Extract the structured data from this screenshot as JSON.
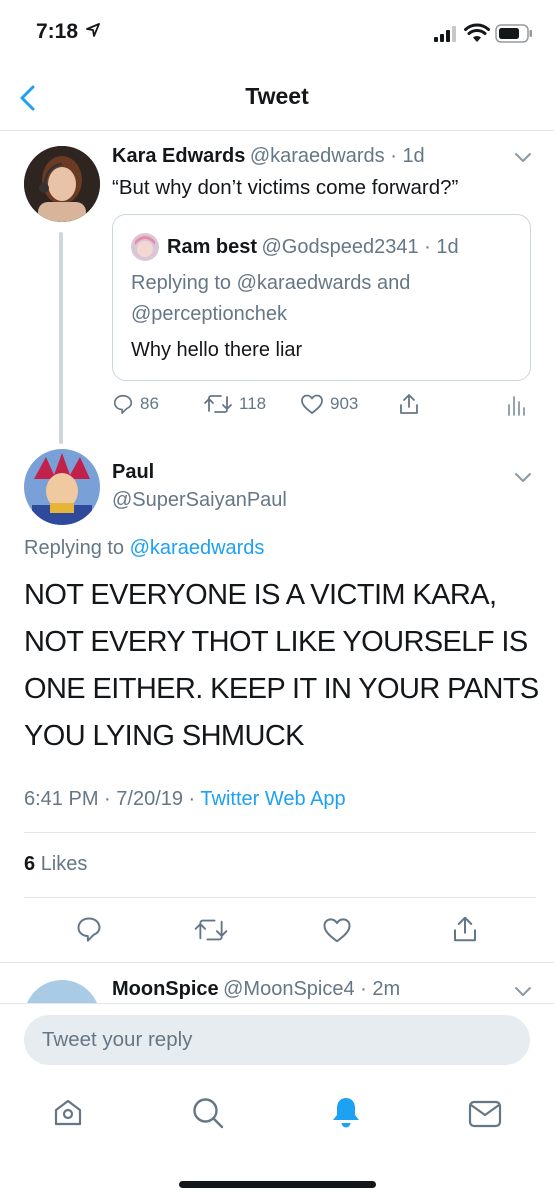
{
  "status_bar": {
    "time": "7:18"
  },
  "nav": {
    "title": "Tweet"
  },
  "parent_tweet": {
    "name": "Kara Edwards",
    "handle": "@karaedwards",
    "age": "1d",
    "text": "“But why don’t victims come forward?”",
    "quoted": {
      "name": "Ram best",
      "handle": "@Godspeed2341",
      "age": "1d",
      "replying_prefix": "Replying to",
      "replying_to_1": "@karaedwards",
      "replying_and": "and",
      "replying_to_2": "@perceptionchek",
      "text": "Why hello there liar"
    },
    "stats": {
      "replies": "86",
      "retweets": "118",
      "likes": "903"
    }
  },
  "main_tweet": {
    "name": "Paul",
    "handle": "@SuperSaiyanPaul",
    "replying_prefix": "Replying to",
    "replying_to": "@karaedwards",
    "text": "NOT EVERYONE IS A VICTIM KARA, NOT EVERY THOT LIKE YOURSELF IS ONE EITHER. KEEP IT IN YOUR PANTS YOU LYING SHMUCK",
    "time": "6:41 PM",
    "date": "7/20/19",
    "source": "Twitter Web App",
    "likes_count": "6",
    "likes_label": "Likes"
  },
  "next_reply": {
    "name": "MoonSpice",
    "handle": "@MoonSpice4",
    "age": "2m"
  },
  "reply_input": {
    "placeholder": "Tweet your reply"
  },
  "colors": {
    "accent": "#1da1f2",
    "secondary_text": "#657786",
    "border": "#e1e8ed"
  },
  "icons": [
    "back-chevron-icon",
    "reply-icon",
    "retweet-icon",
    "like-icon",
    "share-icon",
    "analytics-icon",
    "home-icon",
    "search-icon",
    "notifications-icon",
    "messages-icon"
  ]
}
